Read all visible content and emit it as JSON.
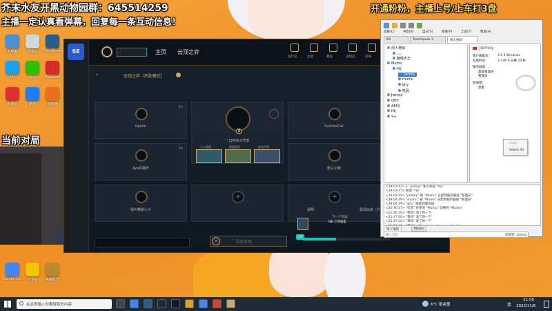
{
  "overlay": {
    "line1": "芥末水友开黑动物园群：645514259",
    "line2": "主播一定认真看弹幕，回复每一条互动信息！",
    "right_top": "开通粉粉，主播上号/上车打3盘",
    "current_team": "当前对局"
  },
  "desktop_icons": [
    {
      "label": "此电脑",
      "color": "#4a90d9"
    },
    {
      "label": "回收站",
      "color": "#cfd8dc"
    },
    {
      "label": "TeamSpeak",
      "color": "#2b5d8c"
    },
    {
      "label": "QQ",
      "color": "#1aa0f0"
    },
    {
      "label": "微信",
      "color": "#2dc100"
    },
    {
      "label": "WeGame",
      "color": "#d42b2b"
    },
    {
      "label": "网易云",
      "color": "#e02f2f"
    },
    {
      "label": "酷狗",
      "color": "#1f7bff"
    },
    {
      "label": "浏览器",
      "color": "#eb6f1d"
    },
    {
      "label": "Google Chrome",
      "color": "#4285f4"
    },
    {
      "label": "YY语音",
      "color": "#f5c400"
    },
    {
      "label": "英雄联盟",
      "color": "#b8892d"
    }
  ],
  "lol": {
    "topnav_home": "主页",
    "topnav_tft": "云顶之弈",
    "mode_title": "云顶之弈（匹配模式）",
    "top_icons": [
      {
        "label": "游行记"
      },
      {
        "label": "主题"
      },
      {
        "label": "藏品"
      },
      {
        "label": "战利品"
      },
      {
        "label": "商城"
      }
    ],
    "slots": [
      {
        "name": "Gpxim",
        "rank": "3+"
      },
      {
        "name": "一口吃块大芥末",
        "rank": "8"
      },
      {
        "name": "SumiaoCat",
        "rank": ""
      },
      {
        "name": "Ayo叫獐柠",
        "rank": "3+"
      },
      {
        "name": "橙子小鹅",
        "rank": ""
      },
      {
        "name": "我叫莓驰小子",
        "rank": ""
      },
      {
        "name": "",
        "rank": ""
      },
      {
        "name": "",
        "rank": ""
      }
    ],
    "lineup_labels": [
      "小小英雄",
      "棋盘皮肤",
      "变化特效"
    ],
    "bottom_left_label": "说明",
    "bottom_right_label": "邀请玩家（7）",
    "next_reward": "下一个奖励",
    "reward_name": "5级 小英雄蛋",
    "level_left": "15",
    "level_right": "16",
    "find_match": "寻找对局"
  },
  "teamspeak": {
    "title": "TeamSpeak 3",
    "menu": [
      "连接(C)",
      "书签(B)",
      "自己(S)",
      "权限(P)",
      "工具(T)",
      "帮助(H)"
    ],
    "tabs": [
      "BX",
      "TeamSpeak 3",
      "闲人地狱"
    ],
    "server_name": "闲人地狱",
    "tree": [
      {
        "text": "闲人地狱",
        "depth": 0
      },
      {
        "text": "。。。",
        "depth": 1
      },
      {
        "text": "静候大王",
        "depth": 1
      },
      {
        "text": "Mumu",
        "depth": 0
      },
      {
        "text": "HiJ",
        "depth": 1
      },
      {
        "text": "Jiemoy",
        "depth": 2,
        "selected": true
      },
      {
        "text": "mumu",
        "depth": 2
      },
      {
        "text": "qhy",
        "depth": 2
      },
      {
        "text": "吃风",
        "depth": 2
      },
      {
        "text": "Jiemoy",
        "depth": 0
      },
      {
        "text": "QHY",
        "depth": 0
      },
      {
        "text": "AEFX",
        "depth": 0
      },
      {
        "text": "HiJ",
        "depth": 0
      },
      {
        "text": "S+",
        "depth": 0
      }
    ],
    "info_name": "Jiemoy",
    "info_version_label": "客户端版本：",
    "info_version": "3.5.3 Windows",
    "info_online_label": "在线时间：",
    "info_online": "3 小时 9 分钟 19 秒",
    "info_groups_label": "服务器组：",
    "info_group1": "超级管理员",
    "info_group2": "管理员",
    "info_channel_label": "频道组：",
    "info_channel": "游客",
    "context_copy": "Copy",
    "context_select_all": "Select All",
    "chat_lines": [
      "<19:03:43> 1 \"jiemoy\" 加入频道 \"HiJ\"",
      "<19:03:47> 频道 \"HiJ\"",
      "<19:03:59> \"jiemoy\" 被 \"Mumu\" 分配到服务器组 \"管理员\"",
      "<19:04:49> \"mumu\" 被 \"Mumu\" 分配到服务器组 \"管理员\"",
      "<19:04:49> \"qhy\" 链接到服务器",
      "<20:30:27> \"吃风\" 连接到 \"Mumu\" 切换到 \"Mumu\"",
      "<21:46:26> \"我叫\" 发了你一下",
      "<21:47:09> \"我叫\" 发了你一下",
      "<21:47:25> \"我叫\" 发了你一下",
      "<21:51:06> \"我叫\": https://www.tsyaoo.com.cn/"
    ],
    "chat_tabs": [
      "闲人地狱",
      "Mumu"
    ],
    "chat_input_placeholder": "输入消息",
    "status": "连接到: jiemoy"
  },
  "taskbar": {
    "search_placeholder": "在这里输入你要搜索的内容",
    "weather": "6°C 雨夹雪",
    "time": "21:56",
    "date": "2022/11/8",
    "lang": "英"
  }
}
